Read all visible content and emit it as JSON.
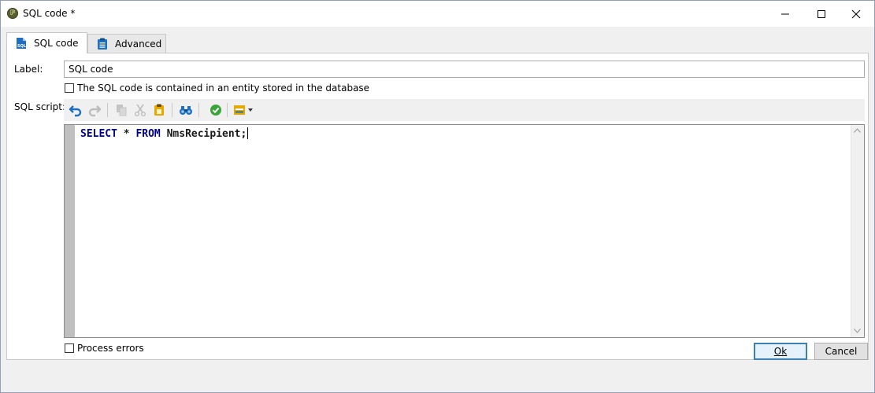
{
  "window": {
    "title": "SQL code *",
    "app_icon_glyph": "ℙ",
    "controls": [
      "minimize-icon",
      "maximize-icon",
      "close-icon"
    ]
  },
  "tabs": [
    {
      "label": "SQL code",
      "icon": "sql-file-icon",
      "active": true
    },
    {
      "label": "Advanced",
      "icon": "clipboard-icon",
      "active": false
    }
  ],
  "form": {
    "label_caption": "Label:",
    "label_value": "SQL code",
    "entity_checkbox_label": "The SQL code is contained in an entity stored in the database",
    "entity_checked": false,
    "sql_script_caption": "SQL script:",
    "process_errors_label": "Process errors",
    "process_errors_checked": false
  },
  "toolbar": {
    "buttons": [
      "undo-icon",
      "redo-icon",
      "copy-icon",
      "cut-icon",
      "paste-icon",
      "find-icon",
      "validate-icon",
      "insert-field-icon"
    ]
  },
  "editor": {
    "tokens": [
      {
        "text": "SELECT",
        "kind": "keyword"
      },
      {
        "text": " * ",
        "kind": "text"
      },
      {
        "text": "FROM",
        "kind": "keyword"
      },
      {
        "text": " NmsRecipient;",
        "kind": "text"
      }
    ]
  },
  "buttons": {
    "ok": "Ok",
    "cancel": "Cancel"
  },
  "colors": {
    "keyword": "#00008b",
    "ok_border": "#3c7fb1",
    "toolbar_blue": "#1f6fbf",
    "toolbar_yellow": "#e8a800",
    "validate_green": "#3aa53a"
  }
}
